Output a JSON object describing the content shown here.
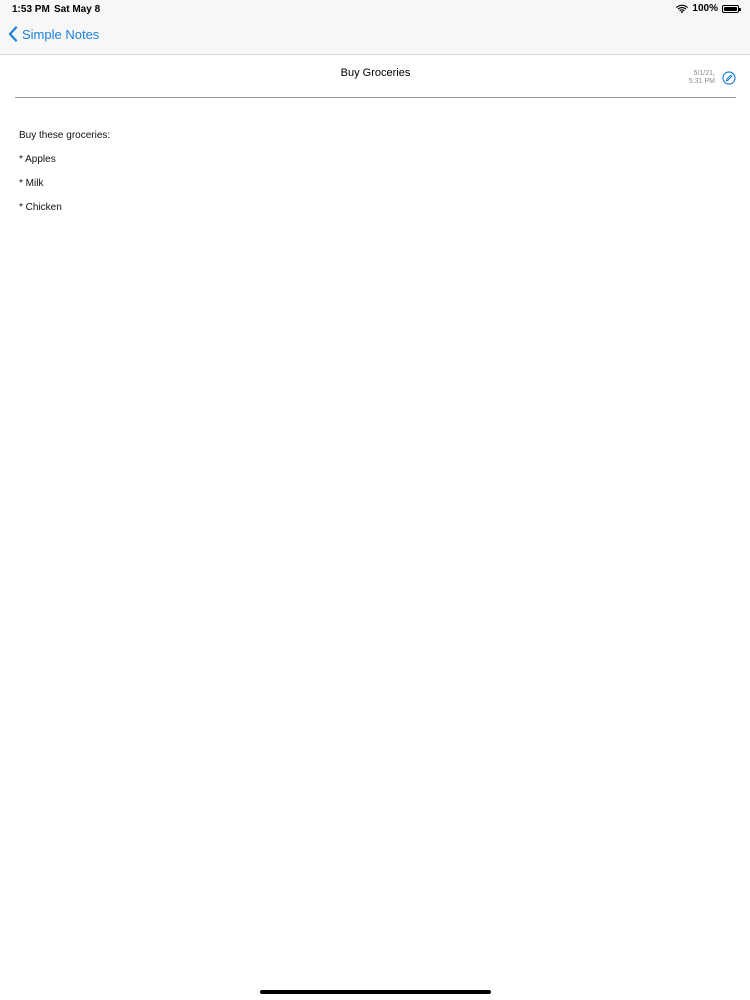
{
  "status_bar": {
    "time": "1:53 PM",
    "date": "Sat May 8",
    "battery_percent_label": "100%",
    "battery_level": 1.0,
    "wifi_icon": "wifi-icon",
    "battery_icon": "battery-icon"
  },
  "nav": {
    "back_label": "Simple Notes",
    "back_icon": "chevron-left-icon"
  },
  "note": {
    "title": "Buy Groceries",
    "date_line1": "5/1/21,",
    "date_line2": "5:31 PM",
    "edit_icon": "edit-icon",
    "body_lines": [
      "Buy these groceries:",
      "* Apples",
      "* Milk",
      "* Chicken"
    ]
  },
  "colors": {
    "accent": "#1c7fd8",
    "bar_background": "#f7f7f8",
    "secondary_text": "#8a8a8e"
  }
}
